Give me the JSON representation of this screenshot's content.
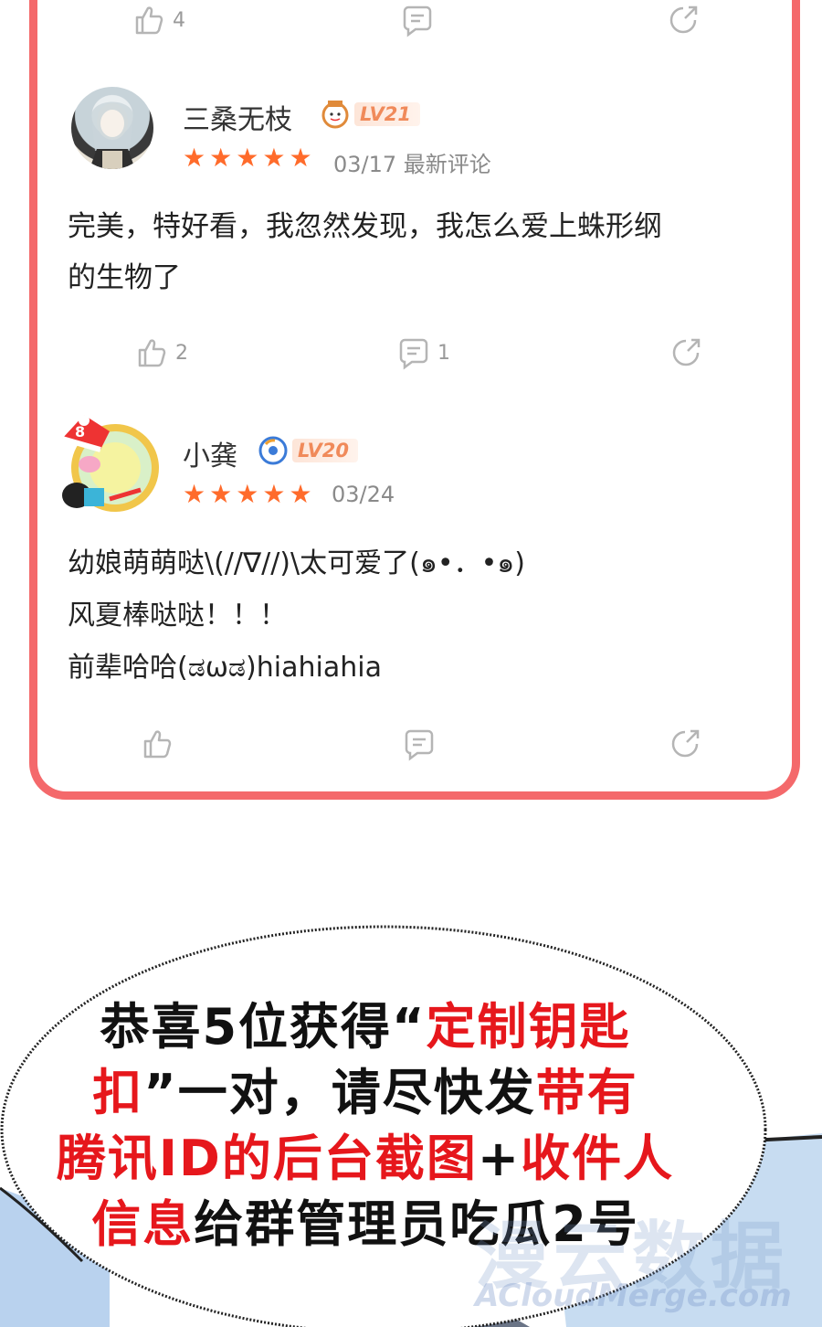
{
  "comments": [
    {
      "likes": "4",
      "replies": "",
      "ref": "top"
    },
    {
      "username": "三桑无枝",
      "level": "LV21",
      "rating": 5,
      "date": "03/17 最新评论",
      "text": "完美，特好看，我忽然发现，我怎么爱上蛛形纲\n的生物了",
      "likes": "2",
      "replies": "1"
    },
    {
      "username": "小龚",
      "level": "LV20",
      "rating": 5,
      "date": "03/24",
      "text": "幼娘萌萌哒\\(//∇//)\\太可爱了(๑•．•๑)\n风夏棒哒哒！！！\n前辈哈哈(ಡωಡ)hiahiahia",
      "likes": "",
      "replies": ""
    }
  ],
  "announcement": {
    "line1_a": "恭喜5位获得“",
    "line1_b": "定制钥匙",
    "line2_a": "扣",
    "line2_b": "”一对，请尽快发",
    "line2_c": "带有",
    "line3_a": "腾讯ID的后台截图",
    "line3_b": "+",
    "line3_c": "收件人",
    "line4_a": "信息",
    "line4_b": "给群管理员吃瓜2号"
  },
  "watermark": {
    "main": "漫云数据",
    "sub": "ACloudMerge.com"
  },
  "colors": {
    "card_border": "#f4696b",
    "star": "#ff6b2b",
    "highlight_text": "#e6171c"
  },
  "icons": [
    "like-icon",
    "comment-icon",
    "share-icon"
  ]
}
